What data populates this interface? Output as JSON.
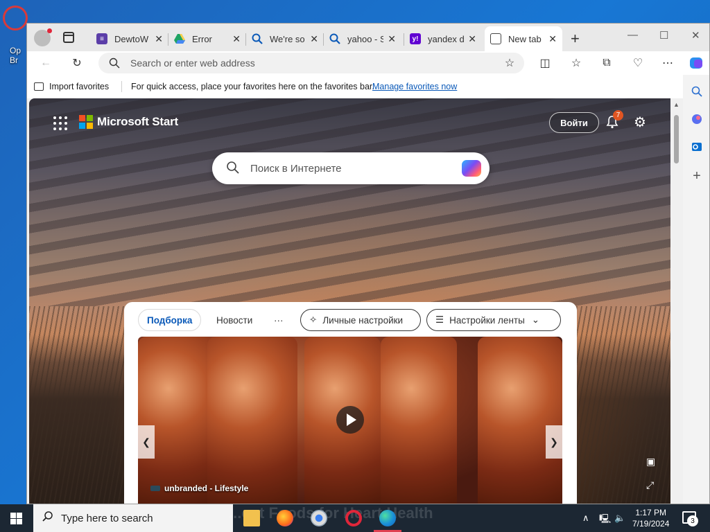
{
  "desktop": {
    "icon_label": "Op\nBr"
  },
  "browser": {
    "tabs": [
      {
        "title": "DewtoW",
        "icon": "dewto-icon",
        "color": "#5b3ea8"
      },
      {
        "title": "Error",
        "icon": "google-drive-icon",
        "color": "#1fa463"
      },
      {
        "title": "We're so",
        "icon": "search-icon",
        "color": "#0a59b8"
      },
      {
        "title": "yahoo - S",
        "icon": "search-icon",
        "color": "#0a59b8"
      },
      {
        "title": "yandex d",
        "icon": "yahoo-icon",
        "color": "#6001d2"
      },
      {
        "title": "New tab",
        "icon": "new-tab-page-icon",
        "color": "#333333"
      }
    ],
    "new_tab_label": "+",
    "address_placeholder": "Search or enter web address",
    "favorites_bar": {
      "import_label": "Import favorites",
      "message": "For quick access, place your favorites here on the favorites bar.",
      "link": "Manage favorites now"
    }
  },
  "page": {
    "brand": "Microsoft Start",
    "sign_in": "Войти",
    "notification_count": "7",
    "search_placeholder": "Поиск в Интернете",
    "feed_tabs": {
      "selected": "Подборка",
      "news": "Новости",
      "more": "···",
      "personalize": "Личные настройки",
      "feed_settings": "Настройки ленты"
    },
    "video_source": "unbranded - Lifestyle",
    "headline_faint": "...ost Foods for Heart Health"
  },
  "taskbar": {
    "search_placeholder": "Type here to search",
    "time": "1:17 PM",
    "date": "7/19/2024",
    "notification_count": "3"
  }
}
